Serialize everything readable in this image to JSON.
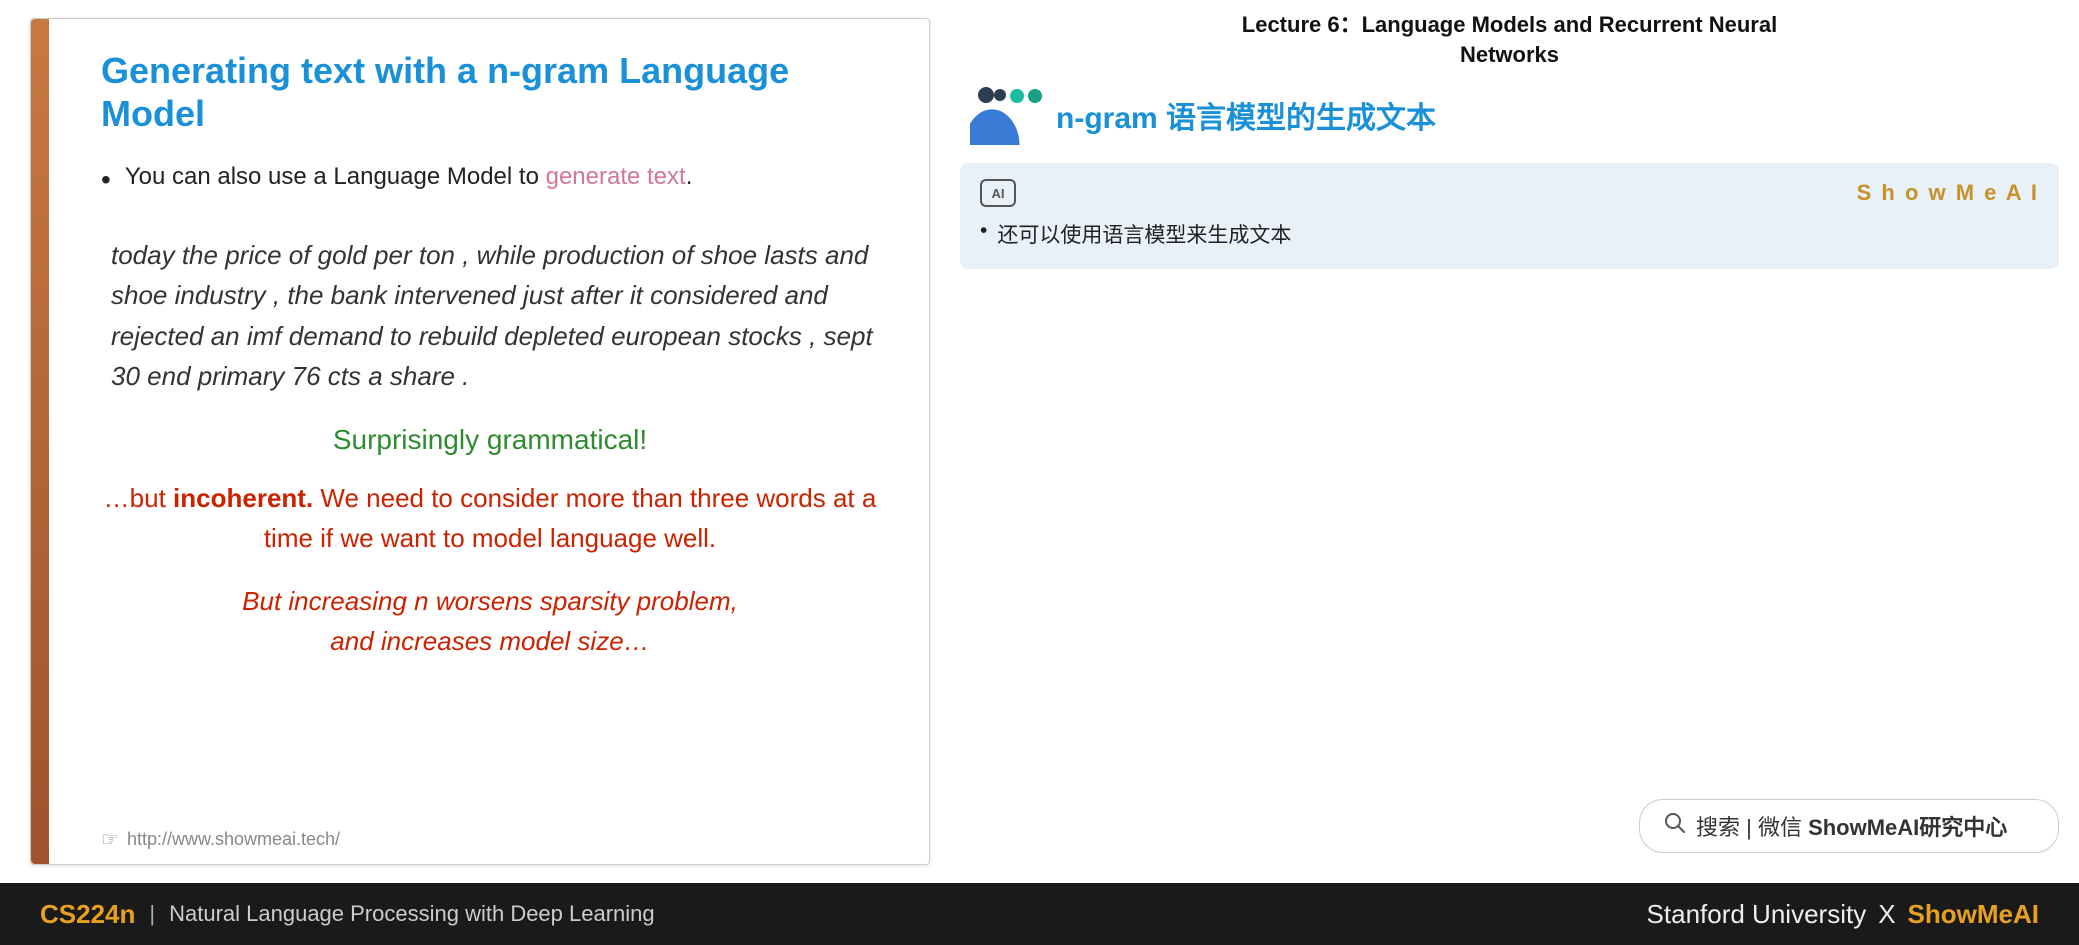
{
  "slide": {
    "title": "Generating text with a n-gram Language Model",
    "bullet1_prefix": "You can also use a Language Model to ",
    "bullet1_highlight": "generate text",
    "bullet1_suffix": ".",
    "italic_text": "today the price of gold per ton , while production of shoe lasts and shoe industry , the bank intervened just after it considered and rejected an imf demand to rebuild depleted european stocks , sept 30 end primary 76 cts a share .",
    "surprisingly": "Surprisingly grammatical!",
    "incoherent_prefix": "…but ",
    "incoherent_bold": "incoherent.",
    "incoherent_suffix": " We need to consider more than three words at a time if we want to model language well.",
    "sparsity_line1": "But increasing ",
    "sparsity_n": "n",
    "sparsity_line1_suffix": " worsens sparsity problem,",
    "sparsity_line2": "and increases model size…",
    "footer_url": "http://www.showmeai.tech/"
  },
  "right": {
    "lecture_title_line1": "Lecture 6：Language Models and Recurrent Neural",
    "lecture_title_line2": "Networks",
    "ngram_title": "n-gram 语言模型的生成文本",
    "card": {
      "brand": "S h o w M e A I",
      "bullet": "还可以使用语言模型来生成文本"
    },
    "search_text": "搜索 | 微信 ",
    "search_brand": "ShowMeAI研究中心"
  },
  "footer": {
    "cs224n": "CS224n",
    "pipe": "|",
    "course_name": "Natural Language Processing with Deep Learning",
    "stanford": "Stanford University",
    "x": "X",
    "showmeai": "ShowMeAI"
  }
}
